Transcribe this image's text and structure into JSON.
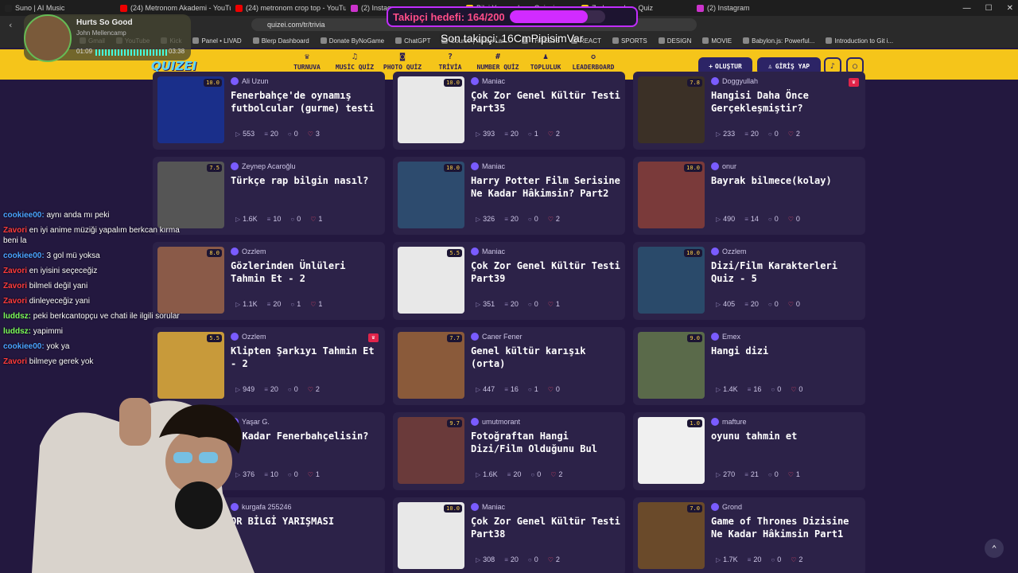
{
  "browser": {
    "tabs": [
      "Suno | AI Music",
      "(24) Metronom Akademi - YouTube",
      "(24) metronom crop top - YouTube",
      "(2) Instagram",
      "Bilgi Yarışmaları - Quizei",
      "Zorlu sorular - Quiz",
      "(2) Instagram"
    ],
    "url": "quizei.com/tr/trivia",
    "bookmarks": [
      "Gmail",
      "YouTube",
      "Kick",
      "Panel • LIVAD",
      "Blerp Dashboard",
      "Donate ByNoGame",
      "ChatGPT",
      "Course | Italian Lan...",
      "THREEJS",
      "REACT",
      "SPORTS",
      "DESIGN",
      "MOVIE",
      "Babylon.js: Powerful...",
      "Introduction to Git i..."
    ]
  },
  "site": {
    "logo": "QUIZEI",
    "nav": [
      {
        "label": "TURNUVA",
        "icon": "trophy-icon"
      },
      {
        "label": "MUSİC QUİZ",
        "icon": "music-icon"
      },
      {
        "label": "PHOTO QUİZ",
        "icon": "camera-icon"
      },
      {
        "label": "TRİVİA",
        "icon": "question-icon"
      },
      {
        "label": "NUMBER QUİZ",
        "icon": "hash-icon"
      },
      {
        "label": "TOPLULUK",
        "icon": "users-icon"
      },
      {
        "label": "LEADERBOARD",
        "icon": "medal-icon"
      }
    ],
    "create_label": "OLUŞTUR",
    "login_label": "GİRİŞ YAP"
  },
  "cards": [
    {
      "author": "Ali Uzun",
      "title": "Fenerbahçe'de oynamış futbolcular (gurme) testi",
      "rating": "10.0",
      "plays": "553",
      "questions": "20",
      "comments": "0",
      "likes": "3",
      "thumb": "#1a2f8a",
      "crown": false
    },
    {
      "author": "Maniac",
      "title": "Çok Zor Genel Kültür Testi Part35",
      "rating": "10.0",
      "plays": "393",
      "questions": "20",
      "comments": "1",
      "likes": "2",
      "thumb": "#e8e8e8",
      "crown": false
    },
    {
      "author": "Doggyullah",
      "title": "Hangisi Daha Önce Gerçekleşmiştir?",
      "rating": "7.8",
      "plays": "233",
      "questions": "20",
      "comments": "0",
      "likes": "2",
      "thumb": "#3b3026",
      "crown": true
    },
    {
      "author": "Zeynep Acaroğlu",
      "title": "Türkçe rap bilgin nasıl?",
      "rating": "7.5",
      "plays": "1.6K",
      "questions": "10",
      "comments": "0",
      "likes": "1",
      "thumb": "#555555",
      "crown": false
    },
    {
      "author": "Maniac",
      "title": "Harry Potter Film Serisine Ne Kadar Hâkimsin? Part2",
      "rating": "10.0",
      "plays": "326",
      "questions": "20",
      "comments": "0",
      "likes": "2",
      "thumb": "#2d4b6e",
      "crown": false
    },
    {
      "author": "onur",
      "title": "Bayrak bilmece(kolay)",
      "rating": "10.0",
      "plays": "490",
      "questions": "14",
      "comments": "0",
      "likes": "0",
      "thumb": "#7a3a3a",
      "crown": false
    },
    {
      "author": "Ozzlem",
      "title": "Gözlerinden Ünlüleri Tahmin Et - 2",
      "rating": "8.0",
      "plays": "1.1K",
      "questions": "20",
      "comments": "1",
      "likes": "1",
      "thumb": "#8a5a48",
      "crown": false
    },
    {
      "author": "Maniac",
      "title": "Çok Zor Genel Kültür Testi Part39",
      "rating": "5.5",
      "plays": "351",
      "questions": "20",
      "comments": "0",
      "likes": "1",
      "thumb": "#e8e8e8",
      "crown": false
    },
    {
      "author": "Ozzlem",
      "title": "Dizi/Film Karakterleri Quiz - 5",
      "rating": "10.0",
      "plays": "405",
      "questions": "20",
      "comments": "0",
      "likes": "0",
      "thumb": "#2a4a6a",
      "crown": false
    },
    {
      "author": "Ozzlem",
      "title": "Klipten Şarkıyı Tahmin Et - 2",
      "rating": "5.5",
      "plays": "949",
      "questions": "20",
      "comments": "0",
      "likes": "2",
      "thumb": "#c89a3a",
      "crown": true
    },
    {
      "author": "Caner Fener",
      "title": "Genel kültür karışık (orta)",
      "rating": "7.7",
      "plays": "447",
      "questions": "16",
      "comments": "1",
      "likes": "0",
      "thumb": "#8a5a3a",
      "crown": false
    },
    {
      "author": "Emex",
      "title": "Hangi dizi",
      "rating": "9.0",
      "plays": "1.4K",
      "questions": "16",
      "comments": "0",
      "likes": "0",
      "thumb": "#5a6a4a",
      "crown": false
    },
    {
      "author": "Yaşar G.",
      "title": "e Kadar Fenerbahçelisin?",
      "rating": "",
      "plays": "376",
      "questions": "10",
      "comments": "0",
      "likes": "1",
      "thumb": "#333333",
      "crown": false
    },
    {
      "author": "umutmorant",
      "title": "Fotoğraftan Hangi Dizi/Film Olduğunu Bul",
      "rating": "9.7",
      "plays": "1.6K",
      "questions": "20",
      "comments": "0",
      "likes": "2",
      "thumb": "#6a3a3a",
      "crown": false
    },
    {
      "author": "mafture",
      "title": "oyunu tahmin et",
      "rating": "1.0",
      "plays": "270",
      "questions": "21",
      "comments": "0",
      "likes": "1",
      "thumb": "#f0f0f0",
      "crown": false
    },
    {
      "author": "kurgafa 255246",
      "title": "OR BİLGİ YARIŞMASI",
      "rating": "",
      "plays": "",
      "questions": "",
      "comments": "",
      "likes": "1",
      "thumb": "#333333",
      "crown": false
    },
    {
      "author": "Maniac",
      "title": "Çok Zor Genel Kültür Testi Part38",
      "rating": "10.0",
      "plays": "308",
      "questions": "20",
      "comments": "0",
      "likes": "2",
      "thumb": "#e8e8e8",
      "crown": false
    },
    {
      "author": "Grond",
      "title": "Game of Thrones Dizisine Ne Kadar Hâkimsin Part1",
      "rating": "7.0",
      "plays": "1.7K",
      "questions": "20",
      "comments": "0",
      "likes": "2",
      "thumb": "#6a4a2a",
      "crown": false
    }
  ],
  "chat": [
    {
      "user": "cookiee00:",
      "text": "aynı anda mı peki",
      "color": "#4aa3ff"
    },
    {
      "user": "Zavori",
      "text": "en iyi anime müziği yapalım berkcan kırma beni la",
      "color": "#ff3b3b"
    },
    {
      "user": "cookiee00:",
      "text": "3 gol mü yoksa",
      "color": "#4aa3ff"
    },
    {
      "user": "Zavori",
      "text": "en iyisini seçeceğiz",
      "color": "#ff3b3b"
    },
    {
      "user": "Zavori",
      "text": "bilmeli değil yani",
      "color": "#ff3b3b"
    },
    {
      "user": "Zavori",
      "text": "dinleyeceğiz yani",
      "color": "#ff3b3b"
    },
    {
      "user": "luddsz:",
      "text": "peki berkcantopçu ve chati ile ilgili sorular",
      "color": "#7dff5a"
    },
    {
      "user": "luddsz:",
      "text": "yapimmi",
      "color": "#7dff5a"
    },
    {
      "user": "cookiee00:",
      "text": "yok ya",
      "color": "#4aa3ff"
    },
    {
      "user": "Zavori",
      "text": "bilmeye gerek yok",
      "color": "#ff3b3b"
    }
  ],
  "overlay": {
    "goal_text": "Takipçi hedefi: 164/200",
    "goal_progress": 0.82,
    "last_follower": "Son takipçi: 16CmPipisimVar",
    "music_title": "Hurts So Good",
    "music_artist": "John Mellencamp",
    "music_elapsed": "01:09",
    "music_total": "03:38"
  }
}
